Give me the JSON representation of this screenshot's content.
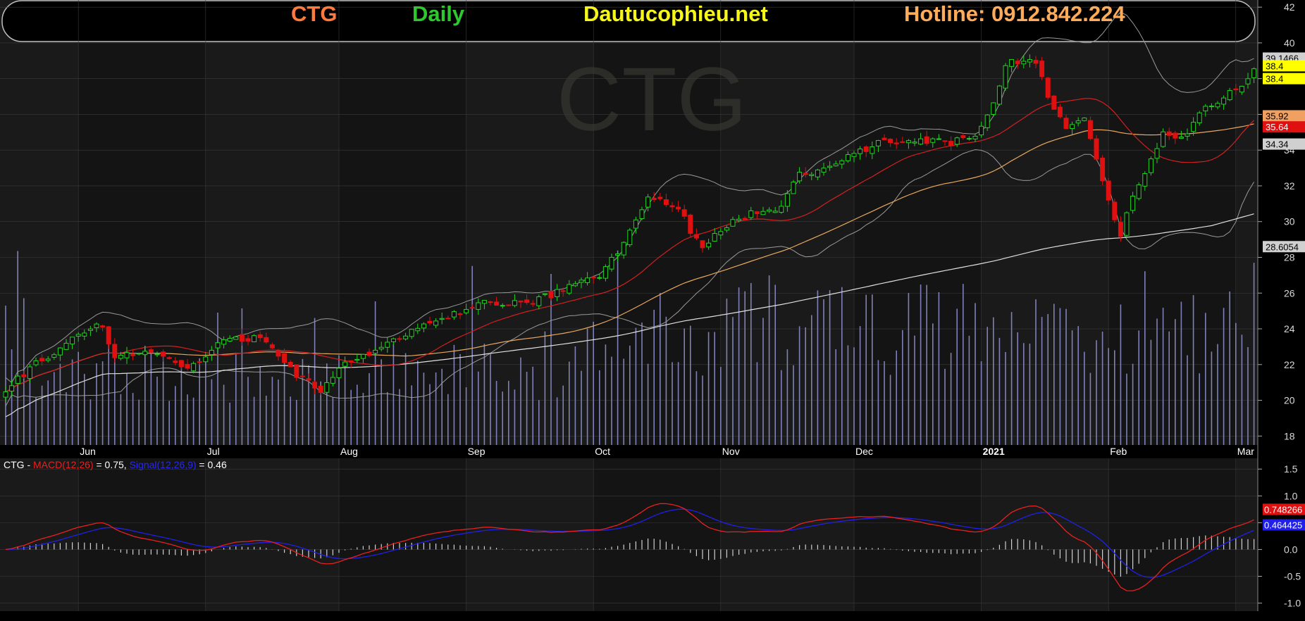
{
  "header": {
    "symbol": "CTG",
    "period": "Daily",
    "site": "Dautucophieu.net",
    "hotline": "Hotline: 0912.842.224",
    "colors": {
      "symbol": "#ff7a3d",
      "period": "#2ec82e",
      "site": "#f6f61a",
      "hotline": "#ffac5a"
    }
  },
  "watermark": "CTG",
  "colors": {
    "background": "#000000",
    "panel": "#1a1a1a",
    "panel_alt": "#141414",
    "grid": "#3a3a3a",
    "up": "#21d321",
    "down": "#e01010",
    "ma_fast": "#d22020",
    "ma_mid": "#e8a85e",
    "ma_slow": "#e0e0e0",
    "bollinger": "#9a9a9a",
    "volume": "#8080b8",
    "macd": "#e82020",
    "signal": "#2020e8",
    "histogram": "#d0d0d0"
  },
  "chart_data": [
    {
      "type": "candlestick",
      "x_labels": [
        "Jun",
        "Jul",
        "Aug",
        "Sep",
        "Oct",
        "Nov",
        "Dec",
        "2021",
        "Feb",
        "Mar"
      ],
      "y_ticks": [
        18,
        20,
        22,
        24,
        26,
        28,
        30,
        32,
        34,
        36,
        38,
        40,
        42
      ],
      "ylim": [
        17.5,
        42.4
      ],
      "indicators": [
        "Bollinger(20)",
        "MA fast",
        "MA mid",
        "MA slow",
        "Volume"
      ],
      "price_labels": [
        {
          "value": "39.1466",
          "y": 39.15,
          "bg": "#d0d0d0",
          "fg": "#000000"
        },
        {
          "value": "38.4",
          "y": 38.72,
          "bg": "#ffff00",
          "fg": "#000000"
        },
        {
          "value": "38.4",
          "y": 38.0,
          "bg": "#ffff00",
          "fg": "#000000"
        },
        {
          "value": "35.92",
          "y": 35.92,
          "bg": "#f0a060",
          "fg": "#000000"
        },
        {
          "value": "35.64",
          "y": 35.3,
          "bg": "#e01010",
          "fg": "#ffffff"
        },
        {
          "value": "34.34",
          "y": 34.34,
          "bg": "#d0d0d0",
          "fg": "#000000"
        },
        {
          "value": "28.6054",
          "y": 28.6,
          "bg": "#d0d0d0",
          "fg": "#000000"
        }
      ],
      "close_keypoints": [
        [
          0,
          20.7
        ],
        [
          5,
          22.0
        ],
        [
          12,
          23.7
        ],
        [
          16,
          24.3
        ],
        [
          18,
          22.4
        ],
        [
          23,
          22.8
        ],
        [
          28,
          22.0
        ],
        [
          31,
          21.9
        ],
        [
          36,
          23.3
        ],
        [
          42,
          23.5
        ],
        [
          45,
          22.4
        ],
        [
          48,
          21.3
        ],
        [
          52,
          20.6
        ],
        [
          56,
          22.2
        ],
        [
          62,
          22.9
        ],
        [
          69,
          24.2
        ],
        [
          76,
          25.1
        ],
        [
          80,
          25.5
        ],
        [
          87,
          25.4
        ],
        [
          94,
          26.6
        ],
        [
          98,
          26.9
        ],
        [
          102,
          28.8
        ],
        [
          106,
          31.5
        ],
        [
          111,
          30.6
        ],
        [
          115,
          28.5
        ],
        [
          119,
          29.8
        ],
        [
          123,
          30.5
        ],
        [
          128,
          30.8
        ],
        [
          131,
          32.6
        ],
        [
          136,
          33.1
        ],
        [
          140,
          33.9
        ],
        [
          145,
          34.5
        ],
        [
          150,
          34.6
        ],
        [
          156,
          34.4
        ],
        [
          160,
          34.9
        ],
        [
          163,
          36.5
        ],
        [
          165,
          38.9
        ],
        [
          170,
          39.0
        ],
        [
          172,
          36.8
        ],
        [
          175,
          35.3
        ],
        [
          178,
          36.0
        ],
        [
          182,
          31.3
        ],
        [
          184,
          29.0
        ],
        [
          186,
          31.6
        ],
        [
          189,
          33.4
        ],
        [
          191,
          35.0
        ],
        [
          194,
          34.6
        ],
        [
          197,
          36.0
        ],
        [
          201,
          37.0
        ],
        [
          204,
          37.5
        ],
        [
          206,
          38.4
        ]
      ],
      "volume_profile": {
        "base_range": [
          5,
          12
        ],
        "spike_range": [
          13,
          24
        ],
        "unit": "relative"
      }
    },
    {
      "type": "macd",
      "legend_prefix": "CTG - ",
      "macd_label": "MACD(12,26)",
      "macd_value": " = 0.75, ",
      "signal_label": "Signal(12,26,9)",
      "signal_value": " = 0.46",
      "y_ticks": [
        "1.5",
        "1.0",
        "0.5",
        "0.0",
        "-0.5",
        "-1.0"
      ],
      "ylim": [
        -1.15,
        1.7
      ],
      "value_labels": [
        {
          "value": "0.748266",
          "y": 0.75,
          "bg": "#e01010",
          "fg": "#ffffff"
        },
        {
          "value": "0.464425",
          "y": 0.46,
          "bg": "#2020e8",
          "fg": "#ffffff"
        }
      ]
    }
  ]
}
